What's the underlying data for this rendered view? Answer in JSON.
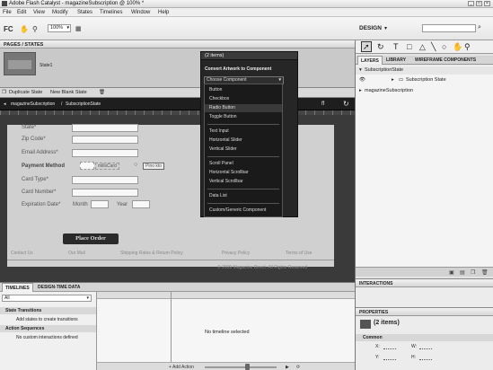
{
  "window": {
    "title": "Adobe Flash Catalyst - magazineSubscription @ 100% *"
  },
  "menu": [
    "File",
    "Edit",
    "View",
    "Modify",
    "States",
    "Timelines",
    "Window",
    "Help"
  ],
  "toolbar": {
    "zoom": "100%",
    "workspace": "DESIGN"
  },
  "pages_states": {
    "header": "PAGES / STATES",
    "state_name": "State1",
    "duplicate_label": "Duplicate State",
    "new_blank_label": "New Blank State"
  },
  "breadcrumb": {
    "root": "magazineSubscription",
    "current": "SubscriptionState"
  },
  "form": {
    "state_label": "State*",
    "zip_label": "Zip Code*",
    "email_label": "Email Address*",
    "payment_label": "Payment Method",
    "payment_opt1": "millsCard",
    "payment_opt2": "Pino kto",
    "card_type_label": "Card Type*",
    "card_number_label": "Card Number*",
    "expiration_label": "Expiration Date*",
    "month_label": "Month",
    "year_label": "Year",
    "place_order": "Place Order",
    "footer_links": [
      "Contact Us",
      "Our Mail",
      "Shipping Rates & Return Policy",
      "Privacy Policy",
      "Terms of Use"
    ],
    "copyright": "© 2009 Magazine Direct. All Rights Reserved"
  },
  "popup": {
    "header": "(2 items)",
    "title": "Convert Artwork to Component",
    "select_value": "Choose Component",
    "options": [
      "Button",
      "Checkbox",
      "Radio Button",
      "Toggle Button",
      "Text Input",
      "Horizontal Slider",
      "Vertical Slider",
      "Scroll Panel",
      "Horizontal Scrollbar",
      "Vertical Scrollbar",
      "Data List",
      "Custom/Generic Component"
    ],
    "selected_index": 2
  },
  "right": {
    "tabs": [
      "LAYERS",
      "LIBRARY",
      "WIREFRAME COMPONENTS"
    ],
    "layers": [
      "SubscriptionState",
      "Subscription State",
      "magazineSubscription"
    ],
    "interactions_header": "INTERACTIONS",
    "properties_header": "PROPERTIES",
    "prop_items": "(2 items)",
    "common": "Common",
    "x_label": "X:",
    "y_label": "Y:",
    "w_label": "W:",
    "h_label": "H:"
  },
  "timeline": {
    "tabs": [
      "TIMELINES",
      "DESIGN-TIME DATA"
    ],
    "filter": "All",
    "state_transitions": "State Transitions",
    "add_states_text": "Add states to create transitions",
    "action_sequences": "Action Sequences",
    "no_custom_text": "No custom interactions defined",
    "no_timeline": "No timeline selected",
    "add_action": "+ Add Action"
  }
}
